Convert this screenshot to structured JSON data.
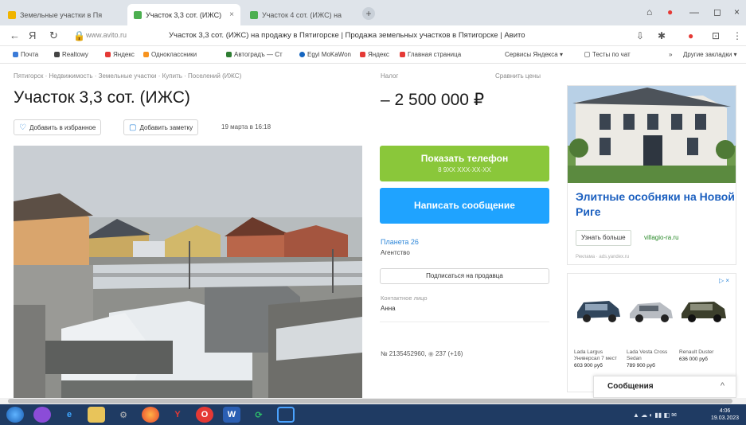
{
  "browser": {
    "tabs": [
      {
        "label": "Земельные участки в Пя"
      },
      {
        "label": "Участок 3,3 сот. (ИЖС)"
      },
      {
        "label": "Участок 4 сот. (ИЖС) на"
      }
    ],
    "new_tab": "+",
    "url": "www.avito.ru",
    "page_title": "Участок 3,3 сот. (ИЖС) на продажу в Пятигорске | Продажа земельных участков в Пятигорске | Авито",
    "bookmarks": [
      {
        "label": "Почта",
        "color": "#3b7bd8"
      },
      {
        "label": "Realtowy",
        "color": "#444"
      },
      {
        "label": "Яндекс",
        "color": "#e53935"
      },
      {
        "label": "Одноклассники",
        "color": "#f7931e"
      },
      {
        "label": "Автоградъ — Ст",
        "color": "#2e7d32"
      },
      {
        "label": "Egyi MoKaWon",
        "color": "#1565c0"
      },
      {
        "label": "Яндекс",
        "color": "#e53935"
      },
      {
        "label": "Главная страница",
        "color": "#e53935"
      },
      {
        "label": "Сервисы Яндекса ▾",
        "color": "#ffffff"
      },
      {
        "label": "Тесты по чат",
        "color": "#999"
      },
      {
        "label": "»",
        "color": "#ffffff"
      },
      {
        "label": "Другие закладки ▾",
        "color": "#ffffff"
      }
    ]
  },
  "listing": {
    "breadcrumbs": "Пятигорск · Недвижимость · Земельные участки · Купить · Поселений (ИЖС)",
    "title": "Участок 3,3 сот. (ИЖС)",
    "favorite_label": "Добавить в избранное",
    "note_label": "Добавить заметку",
    "date": "19 марта в 16:18",
    "price_label": "Налог",
    "compare_label": "Сравнить цены",
    "price": "2 500 000 ₽",
    "price_prefix": "–",
    "phone_button": "Показать телефон",
    "phone_masked": "8 9XX XXX-XX-XX",
    "message_button": "Написать сообщение",
    "seller_name": "Планета 26",
    "seller_type": "Агентство",
    "subscribe_button": "Подписаться на продавца",
    "contact_label": "Контактное лицо",
    "contact_name": "Анна",
    "ad_id": "№ 2135452960,",
    "views": "237 (+16)"
  },
  "ads": {
    "ad1": {
      "headline": "Элитные особняки на Новой Риге",
      "more_button": "Узнать больше",
      "domain": "villagio-ra.ru",
      "disclaimer": "Реклама · ads.yandex.ru"
    },
    "ad2": {
      "tag": "▷ ×",
      "cars": [
        {
          "name": "Lada Largus Универсал 7 мест",
          "price": "603 900 руб",
          "color": "#31465c"
        },
        {
          "name": "Lada Vesta Cross Sedan",
          "price": "789 900 руб",
          "color": "#b8bcc2"
        },
        {
          "name": "Renault Duster",
          "price": "636 000 руб",
          "color": "#3c3f2c"
        }
      ]
    }
  },
  "messages_bar": {
    "label": "Сообщения",
    "chevron": "^"
  },
  "taskbar": {
    "apps": [
      "start",
      "media",
      "ie",
      "explorer",
      "settings",
      "firefox",
      "yandex",
      "opera",
      "word",
      "refresh",
      "screen"
    ],
    "clock_time": "4:06",
    "clock_date": "19.03.2023"
  }
}
